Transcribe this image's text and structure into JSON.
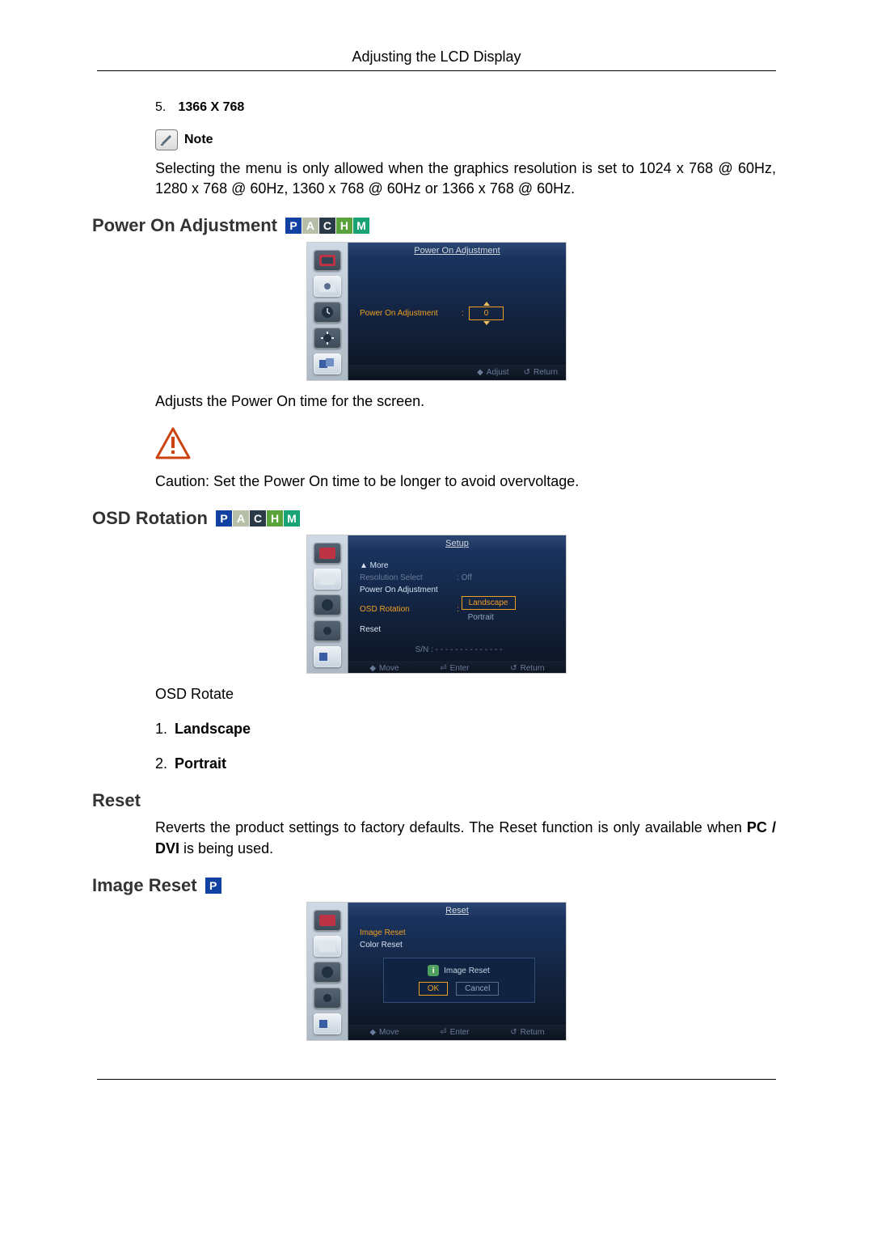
{
  "running_head": "Adjusting the LCD Display",
  "resolution_item": {
    "num": "5.",
    "label": "1366 X 768"
  },
  "note_label": "Note",
  "note_body": "Selecting the menu is only allowed when the graphics resolution is set to 1024 x 768 @ 60Hz, 1280 x 768 @ 60Hz, 1360 x 768 @ 60Hz or 1366 x 768 @ 60Hz.",
  "badges": {
    "p": "P",
    "a": "A",
    "c": "C",
    "h": "H",
    "m": "M"
  },
  "power_on": {
    "heading": "Power On Adjustment",
    "osd_title": "Power On Adjustment",
    "label": "Power On Adjustment",
    "sep": ":",
    "value": "0",
    "foot_adjust": "Adjust",
    "foot_return": "Return",
    "desc": "Adjusts the Power On time for the screen.",
    "caution": "Caution: Set the Power On time to be longer to avoid overvoltage."
  },
  "osd_rotation": {
    "heading": "OSD Rotation",
    "osd_title": "Setup",
    "more": "▲  More",
    "items": {
      "resolution_select": "Resolution Select",
      "resolution_value": "Off",
      "power_on": "Power On Adjustment",
      "osd_rotation": "OSD Rotation",
      "reset": "Reset",
      "opt_landscape": "Landscape",
      "opt_portrait": "Portrait"
    },
    "sn_label": "S/N :",
    "sn_value": "- - - - - - - - - - - - - -",
    "foot_move": "Move",
    "foot_enter": "Enter",
    "foot_return": "Return",
    "desc": "OSD Rotate",
    "list": {
      "n1": "1.",
      "l1": "Landscape",
      "n2": "2.",
      "l2": "Portrait"
    }
  },
  "reset": {
    "heading": "Reset",
    "body_a": "Reverts the product settings to factory defaults. The Reset function is only available when ",
    "body_b": "PC / DVI",
    "body_c": " is being used."
  },
  "image_reset": {
    "heading": "Image Reset",
    "osd_title": "Reset",
    "menu_image": "Image Reset",
    "menu_color": "Color Reset",
    "dialog_title": "Image Reset",
    "ok": "OK",
    "cancel": "Cancel",
    "foot_move": "Move",
    "foot_enter": "Enter",
    "foot_return": "Return"
  }
}
